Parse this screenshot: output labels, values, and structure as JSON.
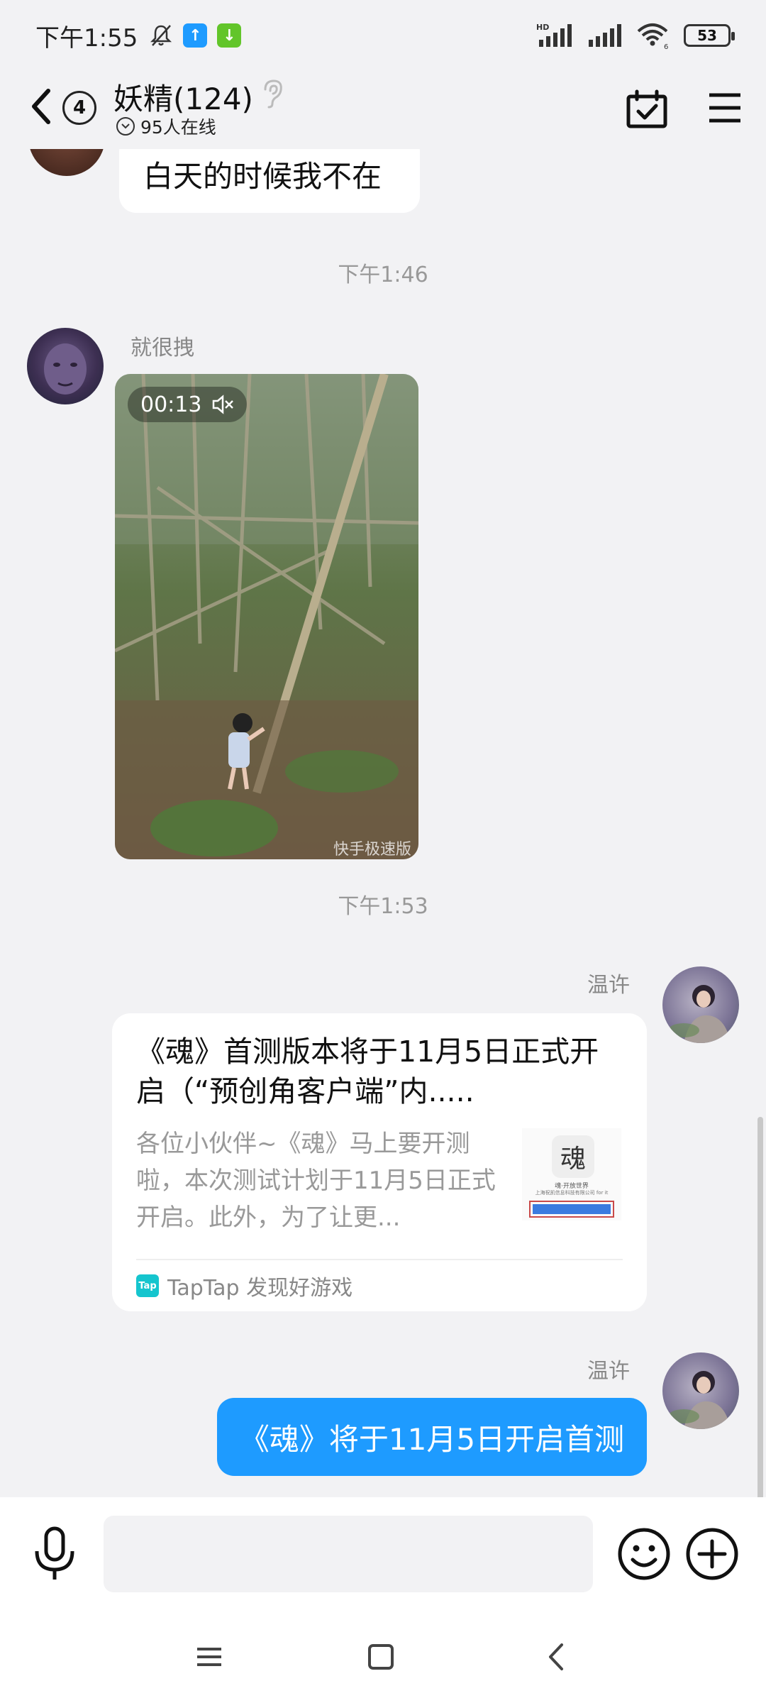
{
  "status_bar": {
    "time": "下午1:55",
    "battery": "53",
    "hd_label": "HD",
    "wifi_sub": "6"
  },
  "header": {
    "unread_count": "4",
    "group_name": "妖精(124)",
    "online_text": "95人在线"
  },
  "messages": {
    "partial_text": "白天的时候我不在",
    "time_1": "下午1:46",
    "sender_1": "就很拽",
    "video_duration": "00:13",
    "video_watermark": "快手极速版",
    "time_2": "下午1:53",
    "sender_2": "温许",
    "card": {
      "title": "《魂》首测版本将于11月5日正式开启（“预创角客户端”内.....",
      "description": "各位小伙伴~《魂》马上要开测啦，本次测试计划于11月5日正式开启。此外，为了让更...",
      "source": "TapTap 发现好游戏",
      "source_logo": "Tap",
      "thumb_glyph": "魂",
      "thumb_caption": "魂·开放世界",
      "thumb_company": "上海祝凯信息科技有限公司 for it"
    },
    "sender_3": "温许",
    "blue_text": "《魂》将于11月5日开启首测"
  },
  "input": {
    "placeholder": ""
  },
  "colors": {
    "accent_blue": "#1e9bff",
    "background": "#f2f2f4"
  }
}
